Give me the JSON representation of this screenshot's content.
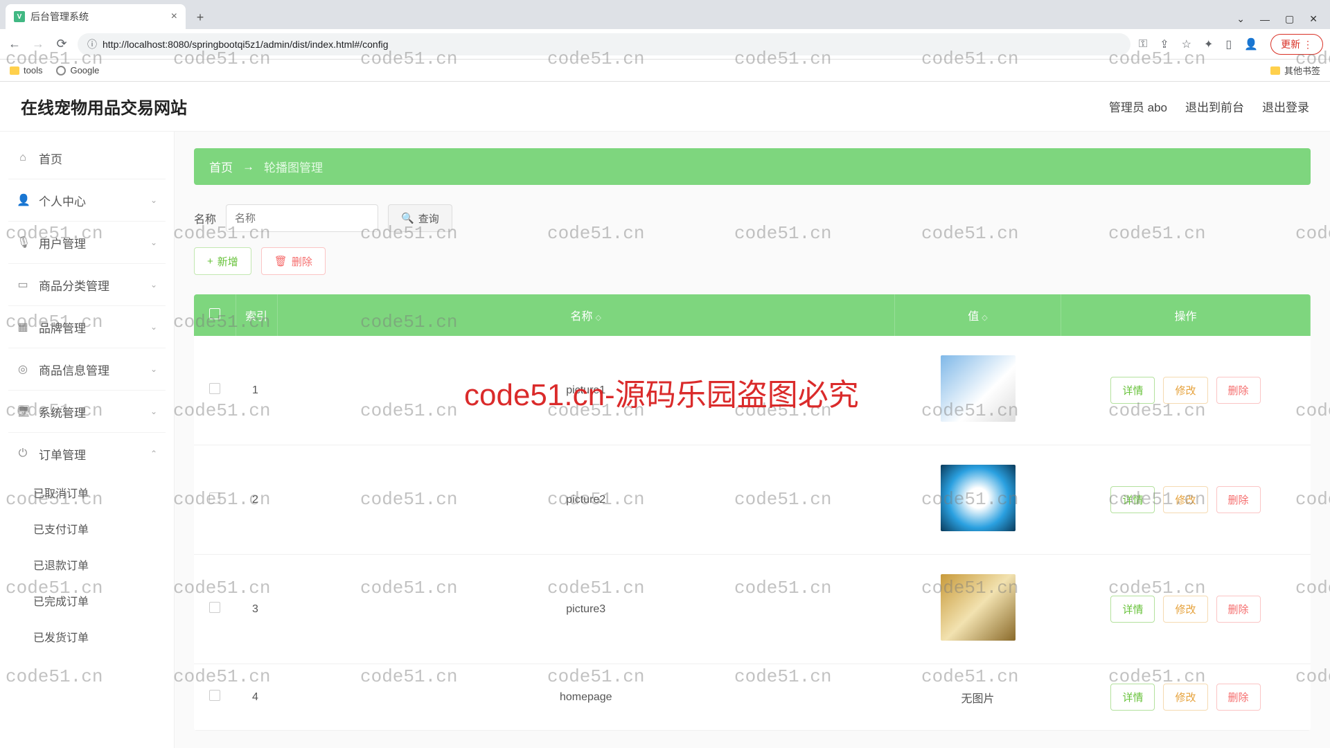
{
  "browser": {
    "tab_title": "后台管理系统",
    "url": "http://localhost:8080/springbootqi5z1/admin/dist/index.html#/config",
    "update_btn": "更新",
    "bookmarks": {
      "tools": "tools",
      "google": "Google",
      "other": "其他书签"
    },
    "win": {
      "down": "⌄",
      "min": "—",
      "max": "▢",
      "close": "✕"
    }
  },
  "header": {
    "app_title": "在线宠物用品交易网站",
    "links": {
      "admin": "管理员 abo",
      "to_front": "退出到前台",
      "logout": "退出登录"
    }
  },
  "sidebar": {
    "items": [
      {
        "label": "首页",
        "icon": "⌂"
      },
      {
        "label": "个人中心",
        "icon": "👤",
        "chev": "⌄"
      },
      {
        "label": "用户管理",
        "icon": "🎙",
        "chev": "⌄"
      },
      {
        "label": "商品分类管理",
        "icon": "▭",
        "chev": "⌄"
      },
      {
        "label": "品牌管理",
        "icon": "▦",
        "chev": "⌄"
      },
      {
        "label": "商品信息管理",
        "icon": "◎",
        "chev": "⌄"
      },
      {
        "label": "系统管理",
        "icon": "🖥",
        "chev": "⌄"
      },
      {
        "label": "订单管理",
        "icon": "⏻",
        "chev": "⌃"
      }
    ],
    "order_subs": [
      "已取消订单",
      "已支付订单",
      "已退款订单",
      "已完成订单",
      "已发货订单"
    ]
  },
  "breadcrumb": {
    "home": "首页",
    "arrow": "→",
    "current": "轮播图管理"
  },
  "search": {
    "label": "名称",
    "placeholder": "名称",
    "query_btn": "查询",
    "add_btn": "新增",
    "del_btn": "删除"
  },
  "table": {
    "headers": {
      "index": "索引",
      "name": "名称",
      "value": "值",
      "ops": "操作"
    },
    "ops_labels": {
      "detail": "详情",
      "edit": "修改",
      "del": "删除"
    },
    "no_image": "无图片",
    "rows": [
      {
        "idx": "1",
        "name": "picture1",
        "img": "a"
      },
      {
        "idx": "2",
        "name": "picture2",
        "img": "b"
      },
      {
        "idx": "3",
        "name": "picture3",
        "img": "c"
      },
      {
        "idx": "4",
        "name": "homepage",
        "img": null
      }
    ]
  },
  "watermark": {
    "text": "code51.cn",
    "big": "code51.cn-源码乐园盗图必究"
  }
}
